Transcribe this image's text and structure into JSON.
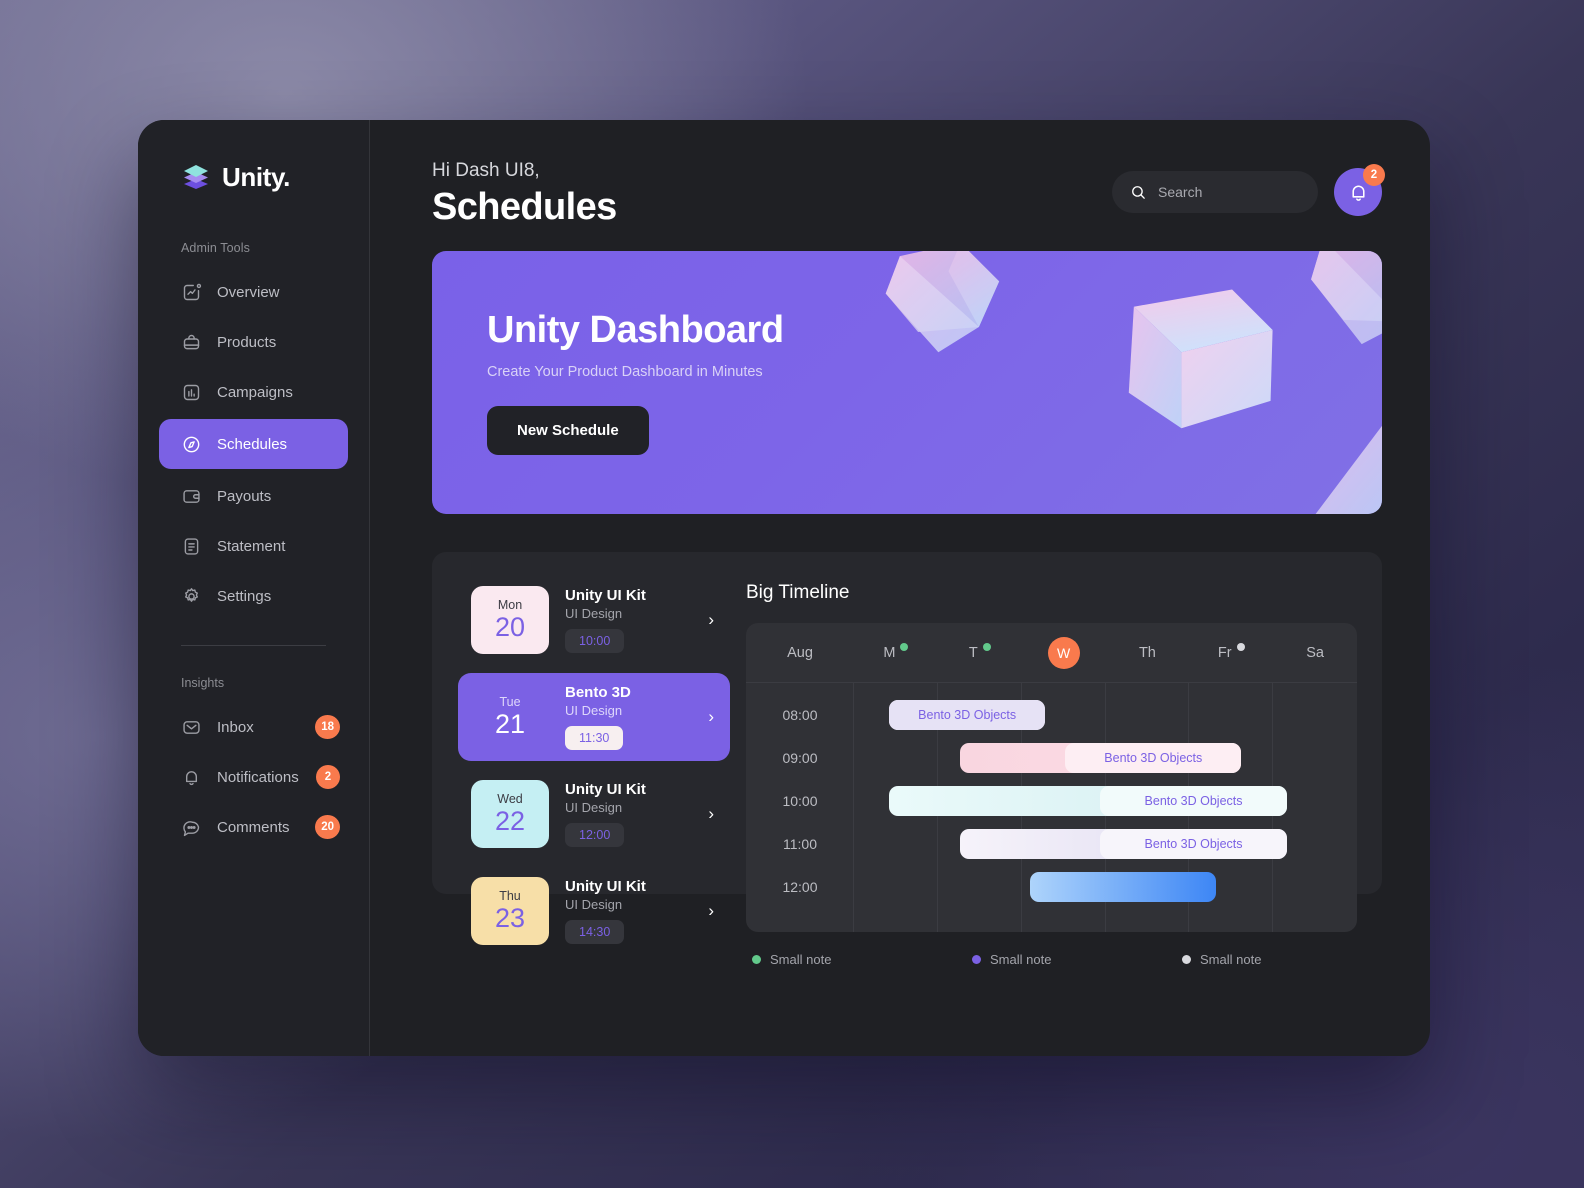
{
  "brand": {
    "name": "Unity.",
    "logo_icon": "layers-icon"
  },
  "sidebar": {
    "admin_label": "Admin Tools",
    "admin_items": [
      {
        "label": "Overview",
        "icon": "chart-square-icon",
        "active": false
      },
      {
        "label": "Products",
        "icon": "bag-icon",
        "active": false
      },
      {
        "label": "Campaigns",
        "icon": "bar-chart-icon",
        "active": false
      },
      {
        "label": "Schedules",
        "icon": "compass-icon",
        "active": true
      },
      {
        "label": "Payouts",
        "icon": "wallet-icon",
        "active": false
      },
      {
        "label": "Statement",
        "icon": "document-icon",
        "active": false
      },
      {
        "label": "Settings",
        "icon": "gear-icon",
        "active": false
      }
    ],
    "insights_label": "Insights",
    "insights_items": [
      {
        "label": "Inbox",
        "icon": "mail-icon",
        "badge": "18"
      },
      {
        "label": "Notifications",
        "icon": "bell-icon",
        "badge": "2"
      },
      {
        "label": "Comments",
        "icon": "comment-icon",
        "badge": "20"
      }
    ]
  },
  "header": {
    "greeting": "Hi Dash UI8,",
    "title": "Schedules",
    "search_placeholder": "Search",
    "search_value": "",
    "notification_count": "2"
  },
  "banner": {
    "title": "Unity Dashboard",
    "subtitle": "Create Your Product Dashboard in Minutes",
    "button_label": "New Schedule",
    "accent_color": "#7b61e4"
  },
  "schedules": [
    {
      "dow": "Mon",
      "day": "20",
      "title": "Unity UI Kit",
      "category": "UI Design",
      "time": "10:00",
      "chip_color": "#fae9f0",
      "active": false
    },
    {
      "dow": "Tue",
      "day": "21",
      "title": "Bento 3D",
      "category": "UI Design",
      "time": "11:30",
      "chip_color": "#7b61e4",
      "active": true
    },
    {
      "dow": "Wed",
      "day": "22",
      "title": "Unity UI Kit",
      "category": "UI Design",
      "time": "12:00",
      "chip_color": "#c5eff3",
      "active": false
    },
    {
      "dow": "Thu",
      "day": "23",
      "title": "Unity UI Kit",
      "category": "UI Design",
      "time": "14:30",
      "chip_color": "#f7dfa8",
      "active": false
    }
  ],
  "timeline": {
    "title": "Big Timeline",
    "month": "Aug",
    "days": [
      {
        "label": "M",
        "dot": "#62c98b",
        "today": false
      },
      {
        "label": "T",
        "dot": "#62c98b",
        "today": false
      },
      {
        "label": "W",
        "dot": null,
        "today": true
      },
      {
        "label": "Th",
        "dot": null,
        "today": false
      },
      {
        "label": "Fr",
        "dot": "#d8d9de",
        "today": false
      },
      {
        "label": "Sa",
        "dot": null,
        "today": false
      }
    ],
    "hours": [
      "08:00",
      "09:00",
      "10:00",
      "11:00",
      "12:00"
    ],
    "events": [
      {
        "row": 0,
        "label": "Bento 3D Objects",
        "start_pct": 7,
        "width_pct": 31,
        "label_start_pct": 7,
        "label_width_pct": 31,
        "bar_from": "#e6e2f5",
        "bar_to": "#e6e2f5",
        "label_bg": "#e6e2f5"
      },
      {
        "row": 1,
        "label": "Bento 3D Objects",
        "start_pct": 21,
        "width_pct": 56,
        "label_start_pct": 42,
        "label_width_pct": 35,
        "bar_from": "#f9d6e0",
        "bar_to": "#fbdde6",
        "label_bg": "#fdeef3"
      },
      {
        "row": 2,
        "label": "Bento 3D Objects",
        "start_pct": 7,
        "width_pct": 79,
        "label_start_pct": 49,
        "label_width_pct": 37,
        "bar_from": "#e9f9fa",
        "bar_to": "#d4eef0",
        "label_bg": "#f2fbfb"
      },
      {
        "row": 3,
        "label": "Bento 3D Objects",
        "start_pct": 21,
        "width_pct": 65,
        "label_start_pct": 49,
        "label_width_pct": 37,
        "bar_from": "#f4f1f8",
        "bar_to": "#dcd8f0",
        "label_bg": "#f7f5fb"
      },
      {
        "row": 4,
        "label": "",
        "start_pct": 35,
        "width_pct": 37,
        "label_start_pct": 0,
        "label_width_pct": 0,
        "bar_from": "#aed4fb",
        "bar_to": "#3d86f5",
        "label_bg": "transparent"
      }
    ],
    "legend": [
      {
        "label": "Small note",
        "color": "#62c98b"
      },
      {
        "label": "Small note",
        "color": "#7b61e4"
      },
      {
        "label": "Small note",
        "color": "#d8d9de"
      }
    ]
  }
}
